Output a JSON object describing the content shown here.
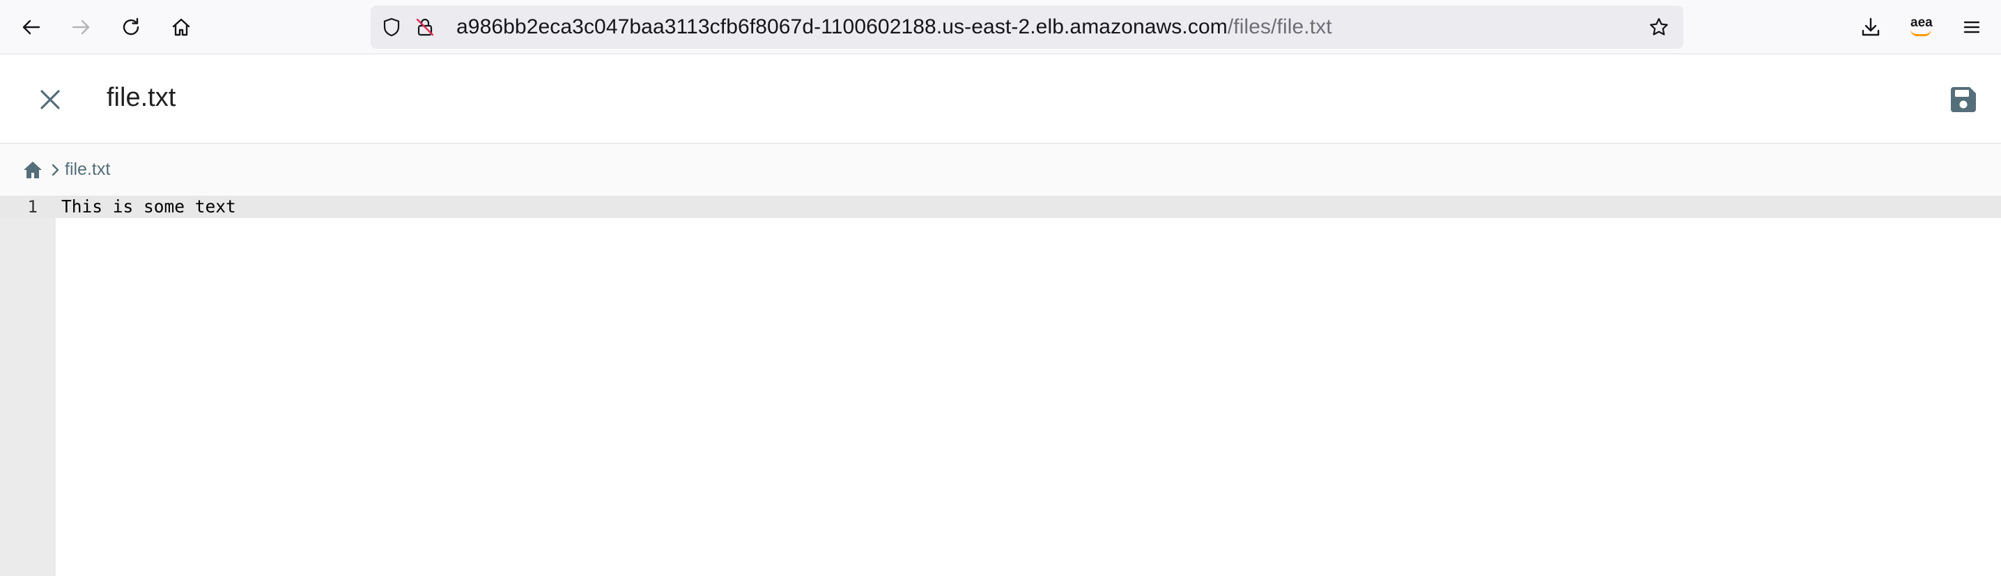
{
  "browser": {
    "url_host": "a986bb2eca3c047baa3113cfb6f8067d-1100602188.us-east-2.elb.amazonaws.com",
    "url_path": "/files/file.txt",
    "account_abbr": "aea"
  },
  "header": {
    "title": "file.txt"
  },
  "breadcrumb": {
    "items": [
      "file.txt"
    ]
  },
  "editor": {
    "lines": [
      {
        "number": "1",
        "text": "This is some text"
      }
    ]
  },
  "colors": {
    "toolbar_bg": "#f9f9fb",
    "urlbar_bg": "#ececf0",
    "gutter_bg": "#ebebeb",
    "active_line_bg": "#e8e8e8",
    "icon_color": "#455a64"
  },
  "icons": {
    "back": "arrow-left-icon",
    "forward": "arrow-right-icon",
    "reload": "reload-icon",
    "home": "home-icon",
    "shield": "shield-icon",
    "insecure_lock": "insecure-lock-icon",
    "bookmark": "star-icon",
    "downloads": "download-icon",
    "menu": "hamburger-menu-icon",
    "close": "close-icon",
    "save": "floppy-disk-icon"
  }
}
